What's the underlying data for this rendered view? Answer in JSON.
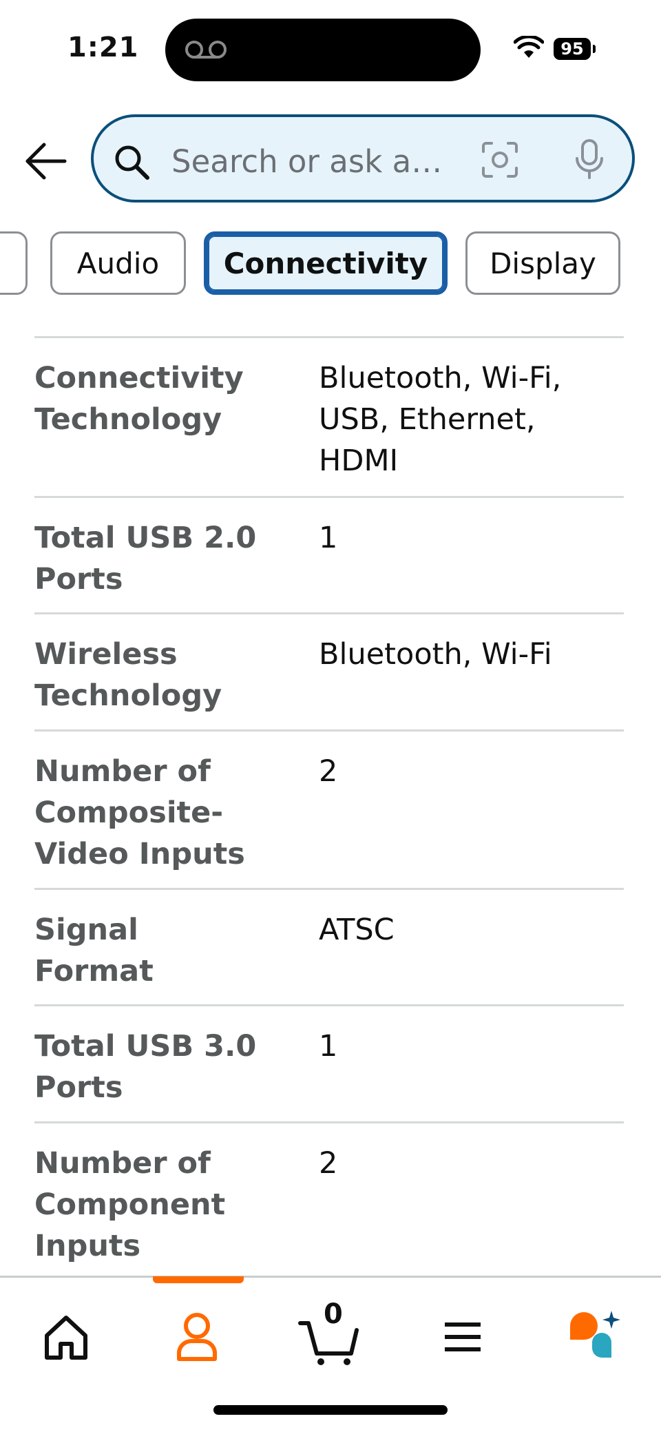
{
  "status_bar": {
    "time": "1:21",
    "battery": "95"
  },
  "search": {
    "placeholder": "Search or ask a…"
  },
  "chips": [
    {
      "label": "Audio"
    },
    {
      "label": "Connectivity"
    },
    {
      "label": "Display"
    }
  ],
  "specs": [
    {
      "key": "Connectivity Technology",
      "value": "Bluetooth, Wi-Fi, USB, Ethernet, HDMI"
    },
    {
      "key": "Total USB 2.0 Ports",
      "value": "1"
    },
    {
      "key": "Wireless Technology",
      "value": "Bluetooth, Wi-Fi"
    },
    {
      "key": "Number of Composite-Video Inputs",
      "value": "2"
    },
    {
      "key": "Signal Format",
      "value": "ATSC"
    },
    {
      "key": "Total USB 3.0 Ports",
      "value": "1"
    },
    {
      "key": "Number of Component Inputs",
      "value": "2"
    }
  ],
  "bottom_nav": {
    "cart_count": "0",
    "active_color": "#ff6a00"
  }
}
